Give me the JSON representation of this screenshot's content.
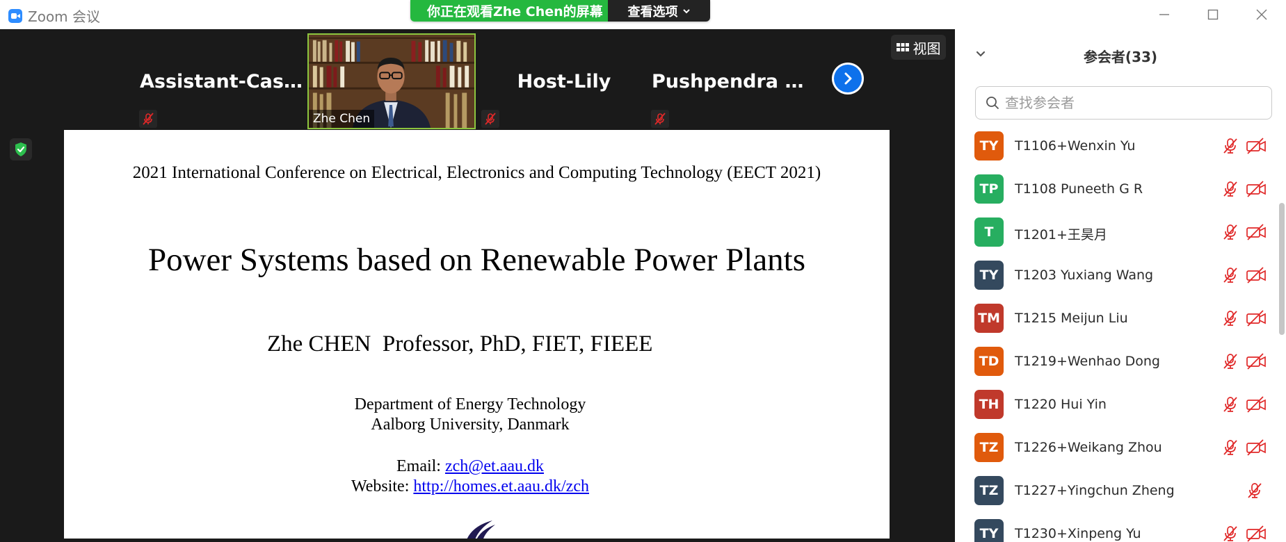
{
  "window": {
    "title": "Zoom 会议",
    "controls": [
      "minimize-icon",
      "maximize-icon",
      "close-icon"
    ]
  },
  "share_banner": {
    "status": "你正在观看Zhe Chen的屏幕",
    "view_options": "查看选项"
  },
  "video_strip": {
    "tiles": [
      {
        "name": "Assistant-Cassie",
        "muted": true
      },
      {
        "name": "Zhe Chen",
        "muted": false,
        "has_video": true
      },
      {
        "name": "Host-Lily",
        "muted": true
      },
      {
        "name": "Pushpendra  Sin...",
        "muted": true
      }
    ],
    "view_button": "视图",
    "next_icon": "chevron-right-icon"
  },
  "slide": {
    "conference": "2021 International Conference on Electrical, Electronics and Computing Technology (EECT 2021)",
    "title": "Power Systems based on Renewable Power Plants",
    "author": "Zhe CHEN  Professor, PhD, FIET, FIEEE",
    "department": "Department of Energy Technology",
    "university": "Aalborg University, Danmark",
    "email_label": "Email: ",
    "email": "zch@et.aau.dk",
    "website_label": "Website: ",
    "website": "http://homes.et.aau.dk/zch"
  },
  "participants": {
    "title": "参会者(33)",
    "search_placeholder": "查找参会者",
    "items": [
      {
        "initials": "TY",
        "name": "T1106+Wenxin Yu",
        "color": "#e05a0c",
        "mic_muted": true,
        "video_off": true
      },
      {
        "initials": "TP",
        "name": "T1108 Puneeth G R",
        "color": "#27ae60",
        "mic_muted": true,
        "video_off": true
      },
      {
        "initials": "T",
        "name": "T1201+王昊月",
        "color": "#27ae60",
        "mic_muted": true,
        "video_off": true
      },
      {
        "initials": "TY",
        "name": "T1203 Yuxiang Wang",
        "color": "#34495e",
        "mic_muted": true,
        "video_off": true
      },
      {
        "initials": "TM",
        "name": "T1215 Meijun Liu",
        "color": "#c0392b",
        "mic_muted": true,
        "video_off": true
      },
      {
        "initials": "TD",
        "name": "T1219+Wenhao Dong",
        "color": "#e05a0c",
        "mic_muted": true,
        "video_off": true
      },
      {
        "initials": "TH",
        "name": "T1220 Hui Yin",
        "color": "#c0392b",
        "mic_muted": true,
        "video_off": true
      },
      {
        "initials": "TZ",
        "name": "T1226+Weikang Zhou",
        "color": "#e05a0c",
        "mic_muted": true,
        "video_off": true
      },
      {
        "initials": "TZ",
        "name": "T1227+Yingchun Zheng",
        "color": "#34495e",
        "mic_muted": true,
        "video_off": false
      },
      {
        "initials": "TY",
        "name": "T1230+Xinpeng Yu",
        "color": "#34495e",
        "mic_muted": true,
        "video_off": true
      }
    ]
  },
  "colors": {
    "accent_blue": "#0e71eb",
    "share_green": "#25b83f",
    "muted_red": "#e02828",
    "active_speaker": "#8dc63f"
  }
}
